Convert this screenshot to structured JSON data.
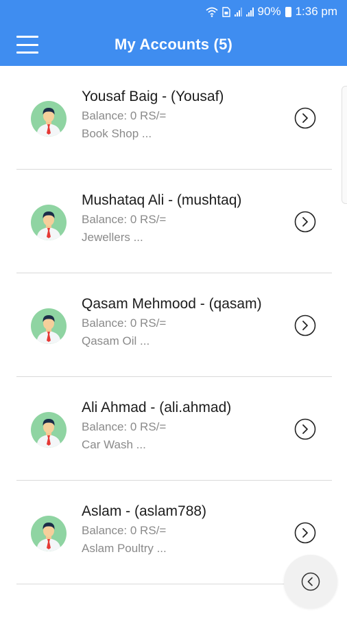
{
  "status_bar": {
    "battery": "90%",
    "time": "1:36 pm",
    "icons": [
      "wifi-icon",
      "sim-icon",
      "signal-icon",
      "signal-icon",
      "battery-icon"
    ]
  },
  "app_bar": {
    "title": "My Accounts (5)",
    "menu_icon": "hamburger-menu-icon",
    "color": "#3f8df0"
  },
  "accounts": [
    {
      "name": "Yousaf Baig - (Yousaf)",
      "balance": "Balance: 0 RS/=",
      "business": "Book Shop ..."
    },
    {
      "name": "Mushataq Ali - (mushtaq)",
      "balance": "Balance: 0 RS/=",
      "business": "Jewellers ..."
    },
    {
      "name": "Qasam Mehmood - (qasam)",
      "balance": "Balance: 0 RS/=",
      "business": "Qasam Oil ..."
    },
    {
      "name": "Ali Ahmad - (ali.ahmad)",
      "balance": "Balance: 0 RS/=",
      "business": "Car Wash ..."
    },
    {
      "name": "Aslam - (aslam788)",
      "balance": "Balance: 0 RS/=",
      "business": "Aslam Poultry ..."
    }
  ],
  "fab": {
    "icon": "chevron-left-circle-icon"
  }
}
